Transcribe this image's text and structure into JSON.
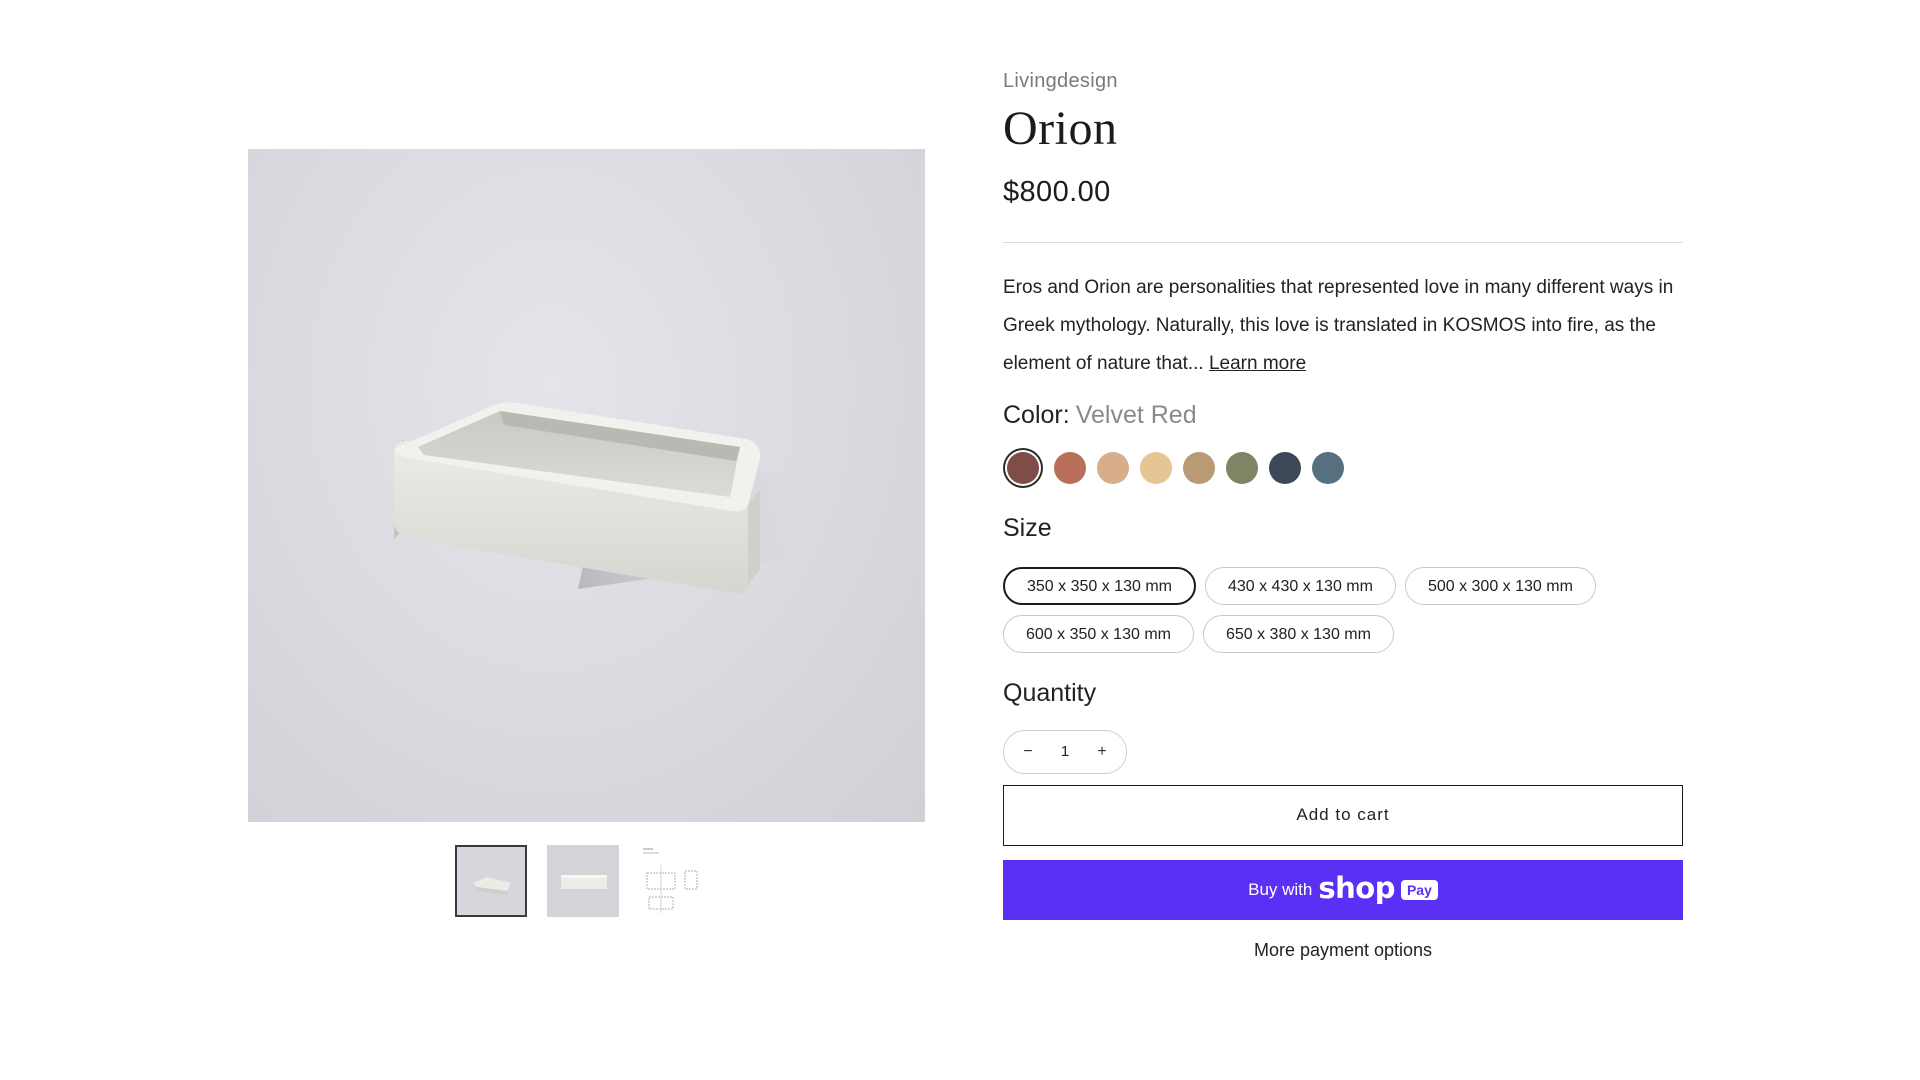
{
  "product": {
    "vendor": "Livingdesign",
    "title": "Orion",
    "price": "$800.00",
    "description": "Eros and Orion are personalities that represented love in many different ways in Greek mythology. Naturally, this love is translated in KOSMOS into fire, as the element of nature that...",
    "learn_more": "Learn more"
  },
  "color": {
    "label": "Color:",
    "selected": "Velvet Red",
    "swatches": [
      {
        "name": "Velvet Red",
        "hex": "#7e4d47"
      },
      {
        "name": "swatch-2",
        "hex": "#b8705a"
      },
      {
        "name": "swatch-3",
        "hex": "#d8ad8a"
      },
      {
        "name": "swatch-4",
        "hex": "#e6c594"
      },
      {
        "name": "swatch-5",
        "hex": "#b89a75"
      },
      {
        "name": "swatch-6",
        "hex": "#7f8465"
      },
      {
        "name": "swatch-7",
        "hex": "#3e4757"
      },
      {
        "name": "swatch-8",
        "hex": "#56707f"
      }
    ]
  },
  "size": {
    "label": "Size",
    "options": [
      "350 x 350 x 130 mm",
      "430 x 430 x 130 mm",
      "500 x 300 x 130 mm",
      "600 x 350 x 130 mm",
      "650 x 380 x 130 mm"
    ],
    "selected_index": 0
  },
  "quantity": {
    "label": "Quantity",
    "value": "1",
    "minus": "−",
    "plus": "+"
  },
  "buttons": {
    "add_to_cart": "Add to cart",
    "buy_with": "Buy with",
    "shop": "shop",
    "pay": "Pay",
    "more_payment_options": "More payment options"
  },
  "colors": {
    "shop_pay": "#5a31f4",
    "image_bg": "#dcd9e0",
    "product_body": "#e9e9e4"
  }
}
